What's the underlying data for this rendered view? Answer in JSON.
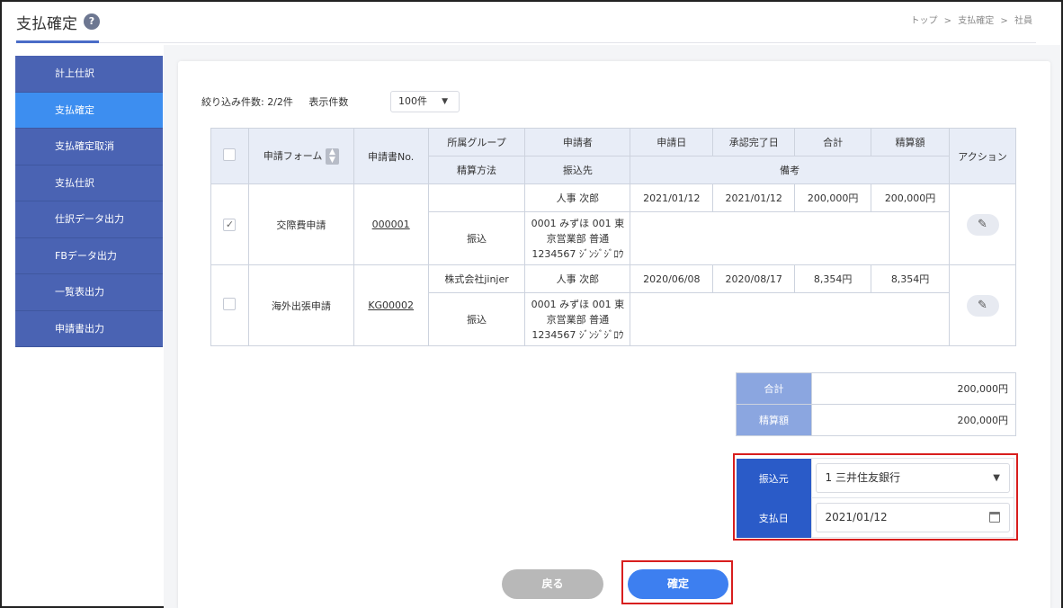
{
  "header": {
    "title": "支払確定",
    "help_icon": "?",
    "breadcrumb": [
      "トップ",
      "支払確定",
      "社員"
    ],
    "breadcrumb_sep": ">"
  },
  "sidebar": {
    "items": [
      {
        "label": "計上仕訳",
        "active": false
      },
      {
        "label": "支払確定",
        "active": true
      },
      {
        "label": "支払確定取消",
        "active": false
      },
      {
        "label": "支払仕訳",
        "active": false
      },
      {
        "label": "仕訳データ出力",
        "active": false
      },
      {
        "label": "FBデータ出力",
        "active": false
      },
      {
        "label": "一覧表出力",
        "active": false
      },
      {
        "label": "申請書出力",
        "active": false
      }
    ]
  },
  "filter": {
    "count_text": "絞り込み件数: 2/2件",
    "per_page_label": "表示件数",
    "per_page_value": "100件"
  },
  "table": {
    "headers_top": [
      "申請フォーム",
      "申請書No.",
      "所属グループ",
      "申請者",
      "申請日",
      "承認完了日",
      "合計",
      "精算額",
      "アクション"
    ],
    "headers_bottom": [
      "精算方法",
      "振込先",
      "備考"
    ],
    "rows": [
      {
        "checked": true,
        "form": "交際費申請",
        "no": "000001",
        "group": "",
        "applicant": "人事 次郎",
        "apply_date": "2021/01/12",
        "approve_date": "2021/01/12",
        "total": "200,000円",
        "settle": "200,000円",
        "method": "振込",
        "bank_line1": "0001 みずほ 001 東",
        "bank_line2": "京営業部 普通",
        "bank_line3": "1234567 ｼﾞﾝｼﾞｼﾞﾛｳ",
        "note": ""
      },
      {
        "checked": false,
        "form": "海外出張申請",
        "no": "KG00002",
        "group": "株式会社jinjer",
        "applicant": "人事 次郎",
        "apply_date": "2020/06/08",
        "approve_date": "2020/08/17",
        "total": "8,354円",
        "settle": "8,354円",
        "method": "振込",
        "bank_line1": "0001 みずほ 001 東",
        "bank_line2": "京営業部 普通",
        "bank_line3": "1234567 ｼﾞﾝｼﾞｼﾞﾛｳ",
        "note": ""
      }
    ]
  },
  "totals": {
    "total_label": "合計",
    "total_value": "200,000円",
    "settle_label": "精算額",
    "settle_value": "200,000円"
  },
  "payform": {
    "source_label": "振込元",
    "source_value": "1 三井住友銀行",
    "date_label": "支払日",
    "date_value": "2021/01/12"
  },
  "buttons": {
    "back": "戻る",
    "confirm": "確定"
  },
  "colors": {
    "sidebar": "#4a63b3",
    "sidebar_active": "#3d8ef0",
    "confirm": "#3d7ff0",
    "highlight": "#d81e1e"
  }
}
